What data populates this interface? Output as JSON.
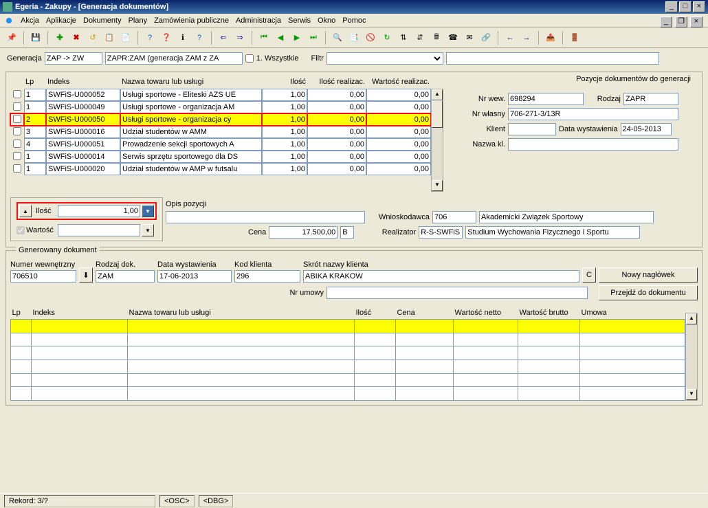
{
  "window": {
    "title": "Egeria - Zakupy - [Generacja dokumentów]"
  },
  "menu": [
    "Akcja",
    "Aplikacje",
    "Dokumenty",
    "Plany",
    "Zamówienia publiczne",
    "Administracja",
    "Serwis",
    "Okno",
    "Pomoc"
  ],
  "filter": {
    "generacja_lbl": "Generacja",
    "generacja_val": "ZAP -> ZW",
    "zapr": "ZAPR:ZAM (generacja ZAM z ZA",
    "chk1_lbl": "1. Wszystkie",
    "filtr_lbl": "Filtr"
  },
  "grid_hdr": {
    "lp": "Lp",
    "ind": "Indeks",
    "naz": "Nazwa towaru lub usługi",
    "il": "Ilość",
    "ilr": "Ilość realizac.",
    "wr": "Wartość realizac."
  },
  "grid_rows": [
    {
      "lp": "1",
      "ind": "SWFiS-U000052",
      "naz": "Usługi sportowe - Eliteski AZS UE",
      "il": "1,00",
      "ilr": "0,00",
      "wr": "0,00",
      "hl": false
    },
    {
      "lp": "1",
      "ind": "SWFiS-U000049",
      "naz": "Usługi sportowe - organizacja AM",
      "il": "1,00",
      "ilr": "0,00",
      "wr": "0,00",
      "hl": false
    },
    {
      "lp": "2",
      "ind": "SWFiS-U000050",
      "naz": "Usługi sportowe - organizacja cy",
      "il": "1,00",
      "ilr": "0,00",
      "wr": "0,00",
      "hl": true
    },
    {
      "lp": "3",
      "ind": "SWFiS-U000016",
      "naz": "Udział studentów w AMM",
      "il": "1,00",
      "ilr": "0,00",
      "wr": "0,00",
      "hl": false
    },
    {
      "lp": "4",
      "ind": "SWFiS-U000051",
      "naz": "Prowadzenie sekcji sportowych A",
      "il": "1,00",
      "ilr": "0,00",
      "wr": "0,00",
      "hl": false
    },
    {
      "lp": "1",
      "ind": "SWFiS-U000014",
      "naz": "Serwis sprzętu sportowego dla DS",
      "il": "1,00",
      "ilr": "0,00",
      "wr": "0,00",
      "hl": false
    },
    {
      "lp": "1",
      "ind": "SWFiS-U000020",
      "naz": "Udział studentów w AMP w futsalu",
      "il": "1,00",
      "ilr": "0,00",
      "wr": "0,00",
      "hl": false
    }
  ],
  "right": {
    "hdr": "Pozycje dokumentów do generacji",
    "nrwew_lbl": "Nr wew.",
    "nrwew": "698294",
    "rodzaj_lbl": "Rodzaj",
    "rodzaj": "ZAPR",
    "nrwlasny_lbl": "Nr własny",
    "nrwlasny": "706-271-3/13R",
    "klient_lbl": "Klient",
    "klient": "",
    "datawyst_lbl": "Data wystawienia",
    "datawyst": "24-05-2013",
    "nazwakl_lbl": "Nazwa kl.",
    "nazwakl": ""
  },
  "ilosc": {
    "lbl": "Ilość",
    "val": "1,00",
    "wartosc_lbl": "Wartość"
  },
  "opis": {
    "lbl": "Opis pozycji",
    "val": "",
    "wniosko_lbl": "Wnioskodawca",
    "wniosko_code": "706",
    "wniosko_name": "Akademicki Związek Sportowy",
    "cena_lbl": "Cena",
    "cena": "17.500,00",
    "cena_unit": "B",
    "realiz_lbl": "Realizator",
    "realiz_code": "R-S-SWFiS",
    "realiz_name": "Studium Wychowania Fizycznego i Sportu"
  },
  "gen": {
    "legend": "Generowany dokument",
    "numwew_lbl": "Numer wewnętrzny",
    "numwew": "706510",
    "rodzaj_lbl": "Rodzaj dok.",
    "rodzaj": "ZAM",
    "data_lbl": "Data wystawienia",
    "data": "17-06-2013",
    "kod_lbl": "Kod klienta",
    "kod": "296",
    "skrot_lbl": "Skrót nazwy klienta",
    "skrot": "ABIKA KRAKOW",
    "c_btn": "C",
    "nrumowy_lbl": "Nr umowy",
    "nrumowy": "",
    "btn1": "Nowy nagłówek",
    "btn2": "Przejdź do dokumentu"
  },
  "btm_hdr": {
    "lp": "Lp",
    "ind": "Indeks",
    "naz": "Nazwa towaru lub usługi",
    "il": "Ilość",
    "cena": "Cena",
    "wn": "Wartość netto",
    "wb": "Wartość brutto",
    "um": "Umowa"
  },
  "status": {
    "rekord": "Rekord: 3/?",
    "osc": "<OSC>",
    "dbg": "<DBG>"
  }
}
